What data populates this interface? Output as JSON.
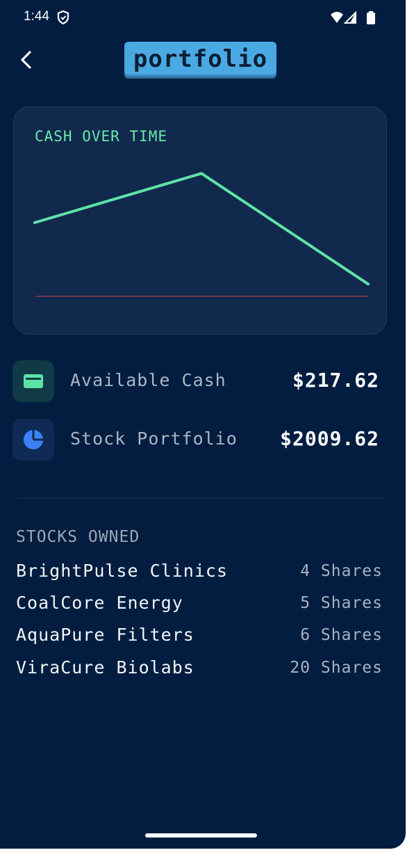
{
  "status_bar": {
    "time": "1:44",
    "icons": [
      "shield-icon",
      "wifi-icon",
      "signal-icon",
      "battery-icon"
    ]
  },
  "header": {
    "back_icon": "chevron-left-icon",
    "title": "portfolio",
    "title_badge_color": "#4aa9e2"
  },
  "chart_card": {
    "title": "CASH OVER TIME",
    "chart_data": {
      "type": "line",
      "title": "CASH OVER TIME",
      "x": [
        1,
        2,
        3
      ],
      "series": [
        {
          "values": [
            1400,
            1800,
            900
          ],
          "color": "#5ee3a6"
        }
      ],
      "baseline_color": "#8a3a4a",
      "ylim": [
        800,
        2000
      ],
      "grid": false,
      "legend": "none"
    }
  },
  "summary": {
    "cash": {
      "icon": "wallet-icon",
      "label": "Available Cash",
      "value": "$217.62",
      "icon_color": "#5ee3a6",
      "icon_bg": "#0f3a46"
    },
    "portfolio": {
      "icon": "pie-chart-icon",
      "label": "Stock Portfolio",
      "value": "$2009.62",
      "icon_color": "#3b82f6",
      "icon_bg": "#0f2a54"
    }
  },
  "stocks": {
    "title": "STOCKS OWNED",
    "items": [
      {
        "name": "BrightPulse Clinics",
        "shares": "4 Shares"
      },
      {
        "name": "CoalCore Energy",
        "shares": "5 Shares"
      },
      {
        "name": "AquaPure Filters",
        "shares": "6 Shares"
      },
      {
        "name": "ViraCure Biolabs",
        "shares": "20 Shares"
      }
    ]
  },
  "nav": {
    "home_indicator": "home-indicator"
  }
}
